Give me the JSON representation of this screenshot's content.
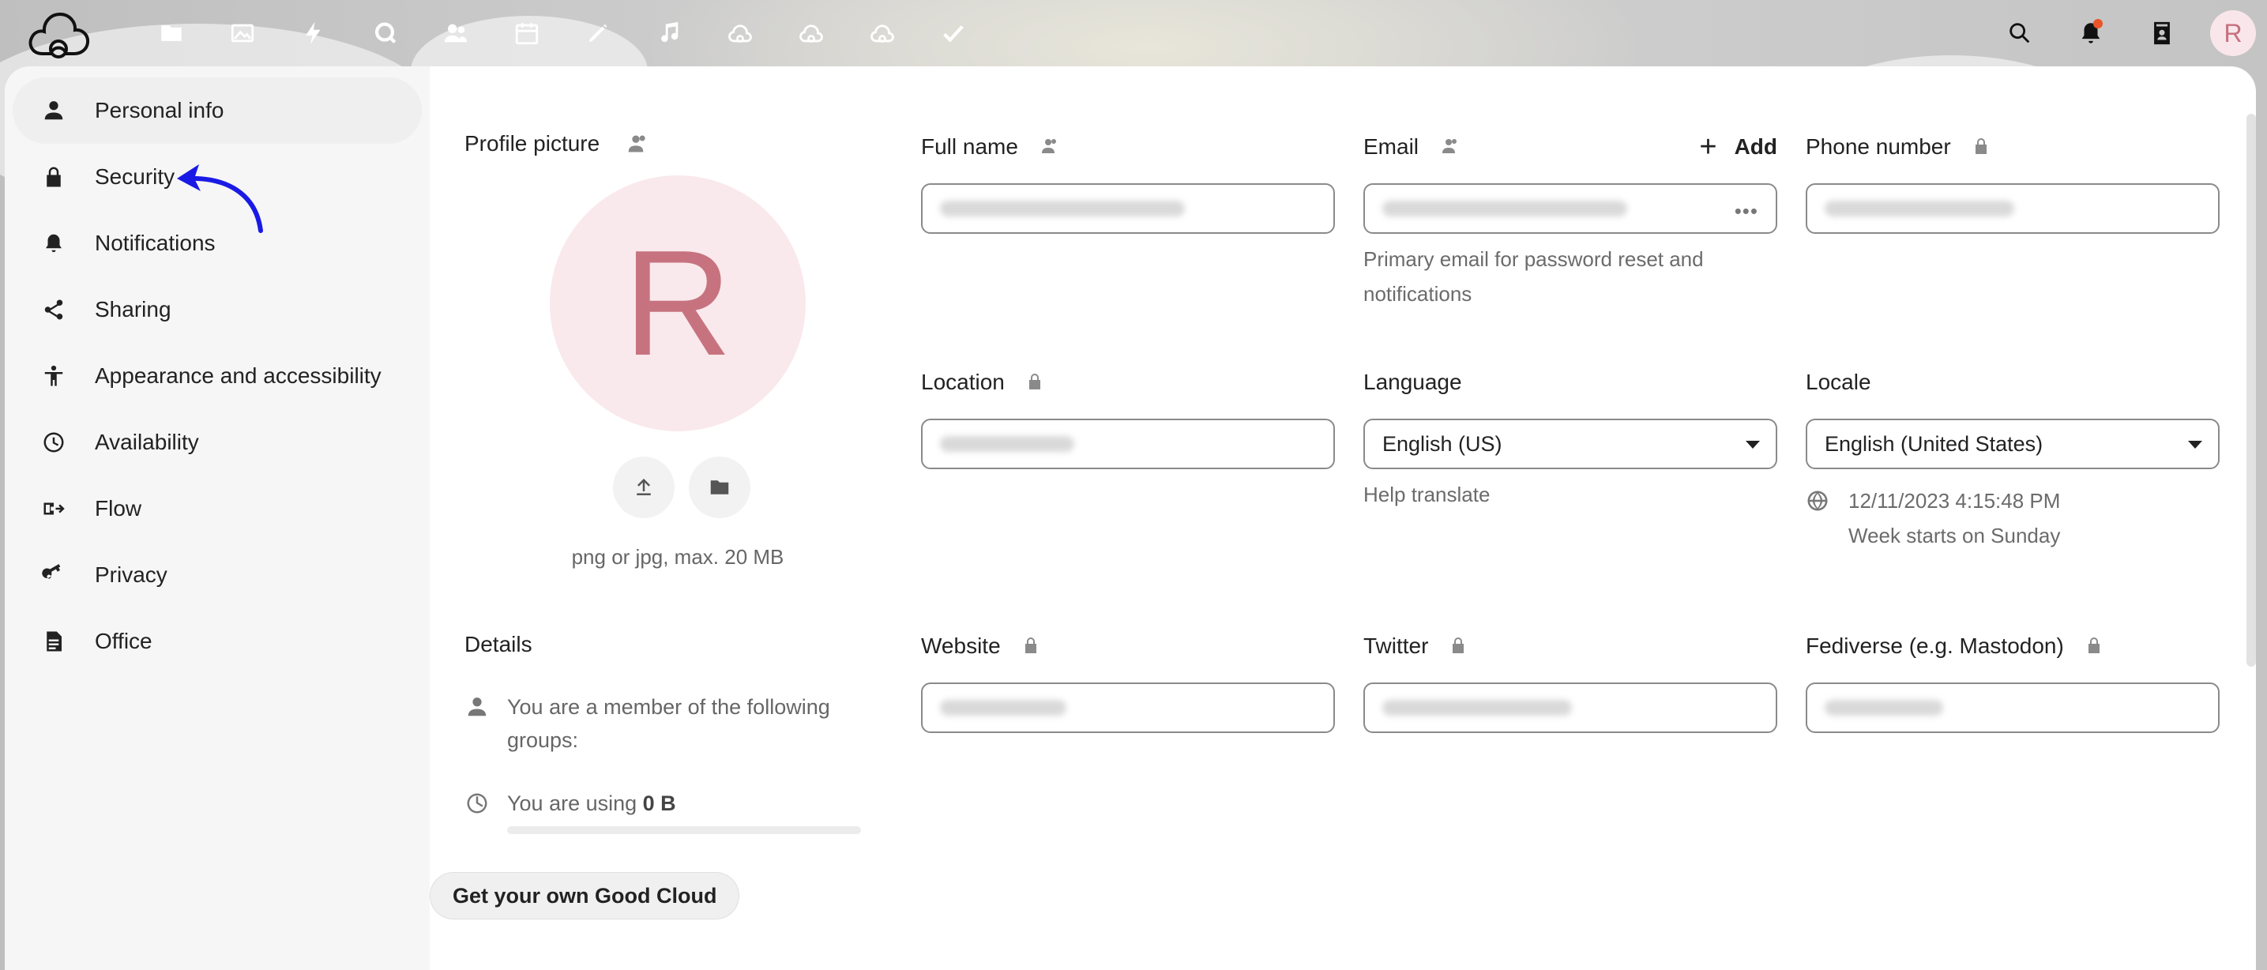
{
  "header": {
    "user_initial": "R",
    "apps": [
      {
        "name": "files-icon"
      },
      {
        "name": "photos-icon"
      },
      {
        "name": "activity-icon"
      },
      {
        "name": "talk-icon"
      },
      {
        "name": "contacts-icon"
      },
      {
        "name": "calendar-icon"
      },
      {
        "name": "notes-icon"
      },
      {
        "name": "music-icon"
      },
      {
        "name": "cloud-icon-1"
      },
      {
        "name": "cloud-icon-2"
      },
      {
        "name": "cloud-icon-3"
      },
      {
        "name": "tasks-icon"
      }
    ],
    "notification_dot_color": "#e9542b"
  },
  "sidebar": {
    "items": [
      {
        "label": "Personal info",
        "icon": "user-icon"
      },
      {
        "label": "Security",
        "icon": "lock-icon"
      },
      {
        "label": "Notifications",
        "icon": "bell-icon"
      },
      {
        "label": "Sharing",
        "icon": "share-icon"
      },
      {
        "label": "Appearance and accessibility",
        "icon": "accessibility-icon"
      },
      {
        "label": "Availability",
        "icon": "clock-icon"
      },
      {
        "label": "Flow",
        "icon": "flow-icon"
      },
      {
        "label": "Privacy",
        "icon": "key-icon"
      },
      {
        "label": "Office",
        "icon": "document-icon"
      }
    ]
  },
  "profile": {
    "title": "Profile picture",
    "initial": "R",
    "hint": "png or jpg, max. 20 MB"
  },
  "details": {
    "title": "Details",
    "groups_text": "You are a member of the following groups:",
    "usage_prefix": "You are using ",
    "usage_value": "0 B",
    "usage_fraction": 0
  },
  "cta": {
    "label": "Get your own Good Cloud"
  },
  "fields": {
    "full_name": {
      "label": "Full name"
    },
    "email": {
      "label": "Email",
      "add_label": "Add",
      "hint": "Primary email for password reset and notifications"
    },
    "phone": {
      "label": "Phone number"
    },
    "location": {
      "label": "Location"
    },
    "language": {
      "label": "Language",
      "value": "English (US)",
      "hint": "Help translate"
    },
    "locale": {
      "label": "Locale",
      "value": "English (United States)",
      "datetime": "12/11/2023 4:15:48 PM",
      "week_start": "Week starts on Sunday"
    },
    "website": {
      "label": "Website"
    },
    "twitter": {
      "label": "Twitter"
    },
    "fediverse": {
      "label": "Fediverse (e.g. Mastodon)"
    }
  },
  "colors": {
    "accent_avatar_bg": "#f9e9ec",
    "accent_avatar_fg": "#c7737f",
    "annotation_arrow": "#1a1ae6"
  }
}
